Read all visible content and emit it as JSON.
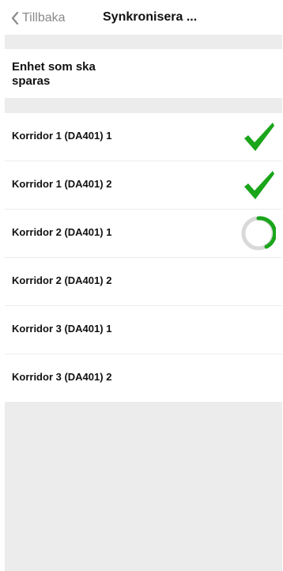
{
  "nav": {
    "back_label": "Tillbaka",
    "title": "Synkronisera ..."
  },
  "section": {
    "title": "Enhet som ska sparas"
  },
  "devices": [
    {
      "label": "Korridor 1 (DA401) 1",
      "status": "done"
    },
    {
      "label": "Korridor 1 (DA401) 2",
      "status": "done"
    },
    {
      "label": "Korridor 2 (DA401) 1",
      "status": "syncing"
    },
    {
      "label": "Korridor 2 (DA401) 2",
      "status": "pending"
    },
    {
      "label": "Korridor 3 (DA401) 1",
      "status": "pending"
    },
    {
      "label": "Korridor 3 (DA401) 2",
      "status": "pending"
    }
  ],
  "colors": {
    "accent_green": "#1aa51a",
    "spinner_track": "#d9d9d9",
    "back_gray": "#8a8a8a",
    "separator": "#ececec"
  },
  "icons": {
    "back": "chevron-left-icon",
    "done": "checkmark-icon",
    "syncing": "loading-spinner-icon"
  }
}
